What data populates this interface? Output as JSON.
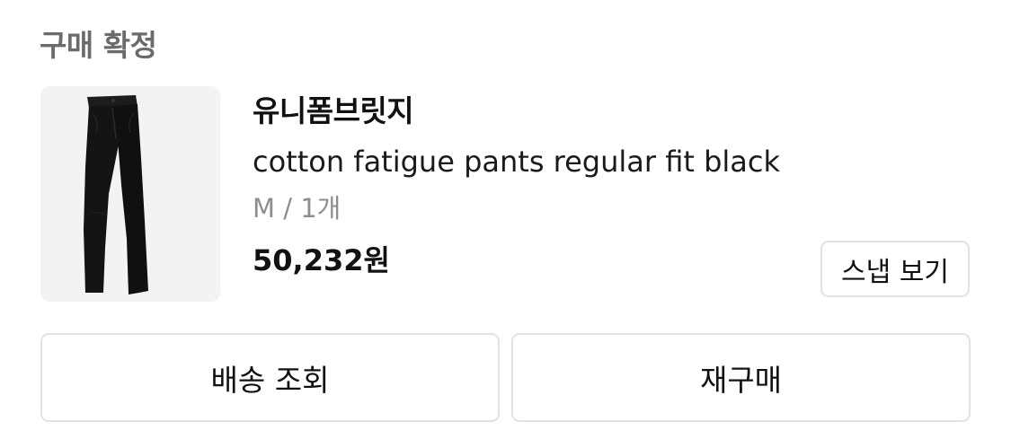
{
  "order": {
    "status_title": "구매 확정"
  },
  "product": {
    "brand": "유니폼브릿지",
    "name": "cotton fatigue pants regular fit black",
    "option": "M / 1개",
    "price": "50,232원",
    "image_icon": "pants-image"
  },
  "buttons": {
    "snap": "스냅 보기",
    "track_shipping": "배송 조회",
    "repurchase": "재구매"
  },
  "colors": {
    "status_text": "#6b6b6b",
    "option_text": "#8e8e8e",
    "border": "#e2e2e2",
    "thumb_bg": "#f3f3f3"
  }
}
